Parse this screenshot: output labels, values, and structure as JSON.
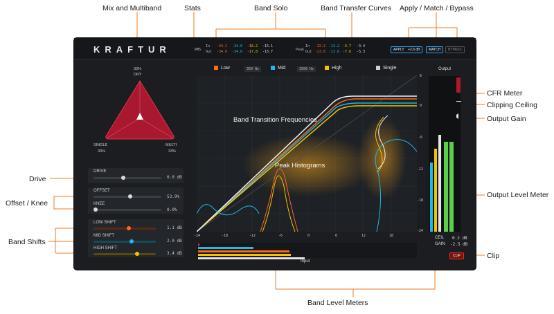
{
  "callouts": {
    "mix_multiband": "Mix and Multiband",
    "stats": "Stats",
    "band_solo": "Band Solo",
    "band_transfer_curves": "Band Transfer Curves",
    "apply_match_bypass": "Apply / Match / Bypass",
    "drive": "Drive",
    "offset_knee": "Offset / Knee",
    "band_shifts": "Band Shifts",
    "cfr_meter": "CFR Meter",
    "clipping_ceiling": "Clipping Ceiling",
    "output_gain": "Output Gain",
    "output_level_meter": "Output Level Meter",
    "clip": "Clip",
    "band_level_meters": "Band Level Meters",
    "band_transition_frequencies": "Band Transition Frequencies",
    "peak_histograms": "Peak Histograms"
  },
  "plugin": {
    "logo": "KRAFTUR",
    "stats": {
      "rms_label": "RMS",
      "in_label": "In",
      "out_label": "Out",
      "peak_label": "Peak",
      "rms_in": [
        "-34.1",
        "-34.6",
        "-16.2",
        "-15.1"
      ],
      "rms_out": [
        "-34.6",
        "-34.6",
        "-17.8",
        "-15.7"
      ],
      "peak_in": [
        "-32.2",
        "-13.2",
        "-6.7",
        "-3.4"
      ],
      "peak_out": [
        "-23.0",
        "-13.6",
        "-7.6",
        "-5.3"
      ]
    },
    "buttons": {
      "apply": "APPLY",
      "apply_value": "+2.6 dB",
      "match": "MATCH",
      "bypass": "BYPASS"
    },
    "mix": {
      "top_value": "33%",
      "top_label": "DRY",
      "single_label": "SINGLE",
      "single_value": "33%",
      "multi_label": "MULTI",
      "multi_value": "33%"
    },
    "drive": {
      "label": "DRIVE",
      "value": "0.0 dB",
      "level": 0.45
    },
    "offset": {
      "label": "OFFSET",
      "value": "53.9%",
      "level": 0.54
    },
    "knee": {
      "label": "KNEE",
      "value": "0.0%",
      "level": 0.0
    },
    "low_shift": {
      "label": "LOW SHIFT",
      "value": "1.1 dB",
      "level": 0.55
    },
    "mid_shift": {
      "label": "MID SHIFT",
      "value": "2.0 dB",
      "level": 0.6
    },
    "high_shift": {
      "label": "HIGH SHIFT",
      "value": "3.4 dB",
      "level": 0.68
    },
    "bands": {
      "low": "Low",
      "low_mid_freq": "350 Hz",
      "mid": "Mid",
      "mid_high_freq": "3500 Hz",
      "high": "High",
      "single": "Single"
    },
    "colors": {
      "low": "#ff6a1a",
      "mid": "#20b8e8",
      "high": "#f5c400",
      "accent": "#2aa6ff",
      "clip": "#e0301e"
    },
    "graph": {
      "x_ticks": [
        "-24",
        "-18",
        "-12",
        "-6",
        "0",
        "6",
        "12",
        "18"
      ],
      "y_ticks": [
        "6",
        "0",
        "-6",
        "-12",
        "-18",
        "-24"
      ]
    },
    "output": {
      "label": "Output",
      "ceil_label": "CEIL",
      "ceil_value": "0.2 dB",
      "gain_label": "GAIN",
      "gain_value": "-2.5 dB",
      "clip_label": "CLIP"
    },
    "input_label": "Input"
  }
}
